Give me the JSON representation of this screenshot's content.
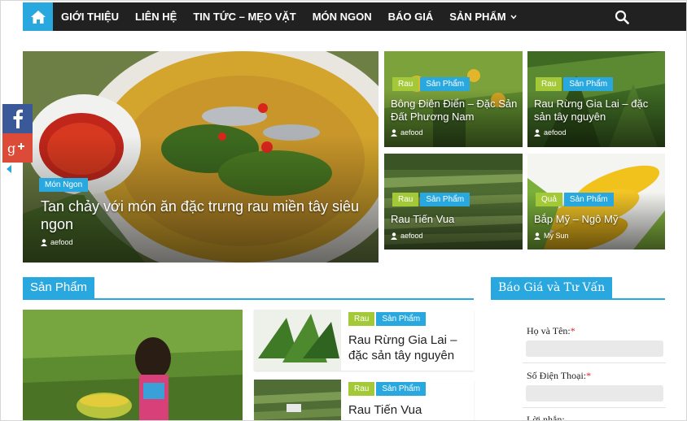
{
  "nav": {
    "home_icon": "home-icon",
    "items": [
      {
        "label": "GIỚI THIỆU"
      },
      {
        "label": "LIÊN HỆ"
      },
      {
        "label": "TIN TỨC – MẸO VẶT"
      },
      {
        "label": "MÓN NGON"
      },
      {
        "label": "BÁO GIÁ"
      },
      {
        "label": "SẢN PHẨM",
        "has_dropdown": true
      }
    ],
    "search_icon": "search-icon",
    "colors": {
      "bar": "#212121",
      "accent": "#29a8e0"
    }
  },
  "social": {
    "facebook_icon": "facebook-icon",
    "gplus_icon": "google-plus-icon",
    "toggle_icon": "chevron-left-icon"
  },
  "hero": {
    "main": {
      "tag": "Món Ngon",
      "title": "Tan chảy với món ăn đặc trưng rau miền tây siêu ngon",
      "author": "aefood"
    },
    "tiles": [
      {
        "tags": [
          "Rau",
          "Sản Phẩm"
        ],
        "title": "Bông Điên Điển – Đặc Sản Đất Phương Nam",
        "author": "aefood"
      },
      {
        "tags": [
          "Rau",
          "Sản Phẩm"
        ],
        "title": "Rau Rừng Gia Lai – đặc sản tây nguyên",
        "author": "aefood"
      },
      {
        "tags": [
          "Rau",
          "Sản Phẩm"
        ],
        "title": "Rau Tiến Vua",
        "author": "aefood"
      },
      {
        "tags": [
          "Quả",
          "Sản Phẩm"
        ],
        "title": "Bắp Mỹ – Ngô Mỹ",
        "author": "My Sun"
      }
    ]
  },
  "products": {
    "heading": "Sản Phẩm",
    "cards": [
      {
        "tags": [
          "Rau",
          "Sản Phẩm"
        ],
        "title": "Rau Rừng Gia Lai – đặc sản tây nguyên"
      },
      {
        "tags": [
          "Rau",
          "Sản Phẩm"
        ],
        "title": "Rau Tiến Vua"
      }
    ]
  },
  "quote": {
    "heading": "Báo Giá và Tư Vấn",
    "fields": [
      {
        "label": "Họ và Tên:",
        "required": "*"
      },
      {
        "label": "Số Điện Thoại:",
        "required": "*"
      },
      {
        "label": "Lời nhắn:"
      }
    ]
  }
}
